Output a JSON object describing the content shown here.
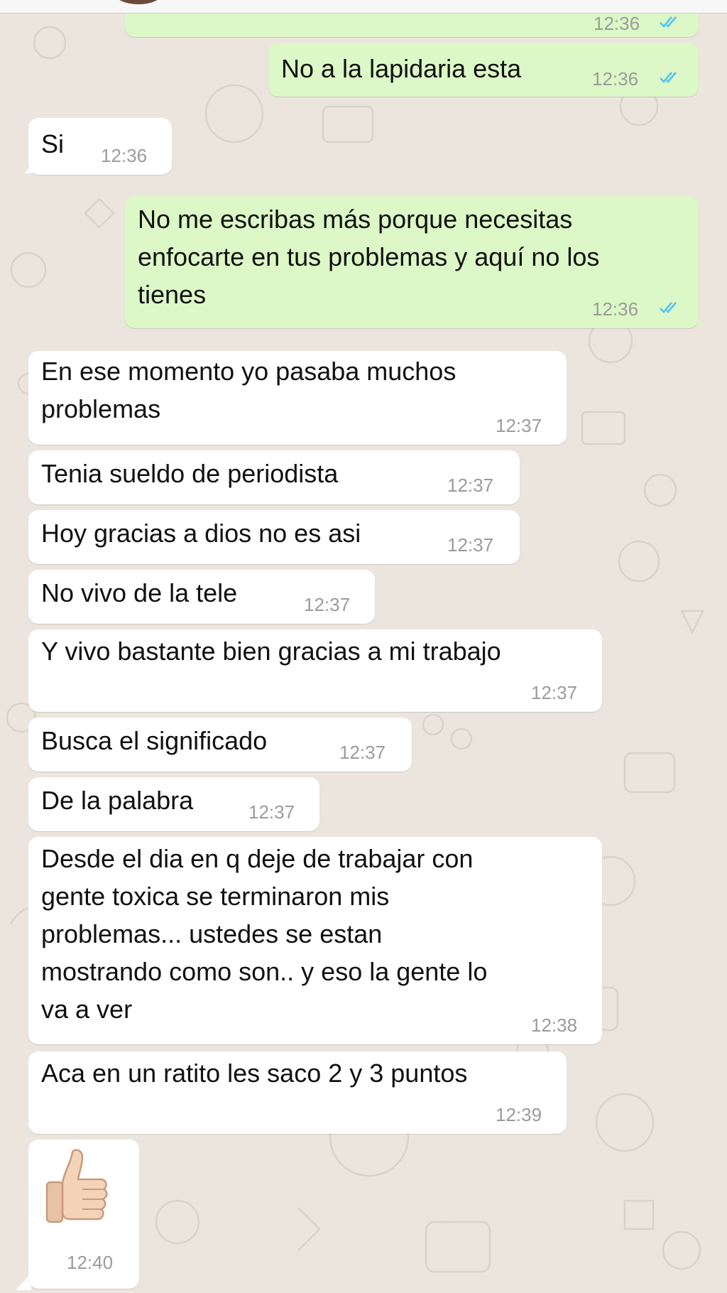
{
  "colors": {
    "wallpaper": "#ece5dd",
    "incoming_bubble": "#ffffff",
    "outgoing_bubble": "#dcf8c6",
    "read_ticks": "#4fc3f7",
    "timestamp": "#9b9b9b"
  },
  "chat": {
    "messages": [
      {
        "direction": "out",
        "text": "",
        "time": "12:36",
        "status": "read-ticks-icon"
      },
      {
        "direction": "out",
        "text": "No a la lapidaria esta",
        "time": "12:36",
        "status": "read-ticks-icon"
      },
      {
        "direction": "in",
        "text": "Si",
        "time": "12:36"
      },
      {
        "direction": "out",
        "text": "No me escribas más porque necesitas\nenfocarte en tus problemas y aquí no los\ntienes",
        "time": "12:36",
        "status": "read-ticks-icon"
      },
      {
        "direction": "in",
        "text": "En ese momento yo pasaba muchos\nproblemas",
        "time": "12:37"
      },
      {
        "direction": "in",
        "text": "Tenia sueldo de periodista",
        "time": "12:37"
      },
      {
        "direction": "in",
        "text": "Hoy gracias a dios no es asi",
        "time": "12:37"
      },
      {
        "direction": "in",
        "text": "No vivo de la tele",
        "time": "12:37"
      },
      {
        "direction": "in",
        "text": "Y vivo bastante bien gracias a mi trabajo",
        "time": "12:37"
      },
      {
        "direction": "in",
        "text": "Busca el significado",
        "time": "12:37"
      },
      {
        "direction": "in",
        "text": "De la palabra",
        "time": "12:37"
      },
      {
        "direction": "in",
        "text": "Desde el dia en q deje de trabajar con\ngente toxica se terminaron mis\nproblemas... ustedes se estan\nmostrando como son.. y eso la gente lo\nva a ver",
        "time": "12:38"
      },
      {
        "direction": "in",
        "text": "Aca en un ratito les saco 2 y 3 puntos",
        "time": "12:39"
      },
      {
        "direction": "in",
        "emoji": "thumbs-up-emoji-icon",
        "time": "12:40"
      }
    ]
  }
}
